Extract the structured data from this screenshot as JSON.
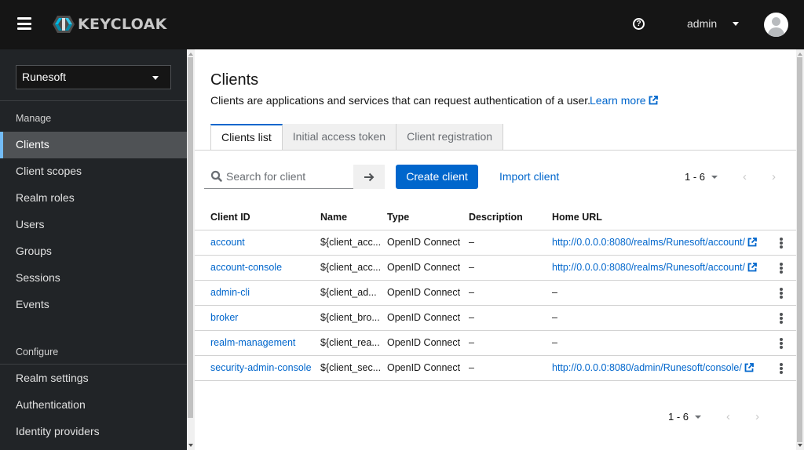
{
  "header": {
    "brand": "KEYCLOAK",
    "help_icon": "question-circle-icon",
    "user_name": "admin",
    "avatar_icon": "user-avatar-icon"
  },
  "sidebar": {
    "realm": "Runesoft",
    "groups": [
      {
        "title": "Manage",
        "items": [
          {
            "label": "Clients",
            "active": true
          },
          {
            "label": "Client scopes"
          },
          {
            "label": "Realm roles"
          },
          {
            "label": "Users"
          },
          {
            "label": "Groups"
          },
          {
            "label": "Sessions"
          },
          {
            "label": "Events"
          }
        ]
      },
      {
        "title": "Configure",
        "items": [
          {
            "label": "Realm settings"
          },
          {
            "label": "Authentication"
          },
          {
            "label": "Identity providers"
          }
        ]
      }
    ]
  },
  "page": {
    "title": "Clients",
    "description": "Clients are applications and services that can request authentication of a user.",
    "learn_more": "Learn more",
    "tabs": [
      {
        "label": "Clients list",
        "active": true
      },
      {
        "label": "Initial access token"
      },
      {
        "label": "Client registration"
      }
    ]
  },
  "toolbar": {
    "search_placeholder": "Search for client",
    "search_value": "",
    "create_label": "Create client",
    "import_label": "Import client",
    "pagination": "1 - 6",
    "prev": "‹",
    "next": "›"
  },
  "table": {
    "columns": [
      "Client ID",
      "Name",
      "Type",
      "Description",
      "Home URL"
    ],
    "rows": [
      {
        "client_id": "account",
        "name": "${client_acc...",
        "type": "OpenID Connect",
        "description": "–",
        "home_url": "http://0.0.0.0:8080/realms/Runesoft/account/",
        "is_link": true
      },
      {
        "client_id": "account-console",
        "name": "${client_acc...",
        "type": "OpenID Connect",
        "description": "–",
        "home_url": "http://0.0.0.0:8080/realms/Runesoft/account/",
        "is_link": true
      },
      {
        "client_id": "admin-cli",
        "name": "${client_ad...",
        "type": "OpenID Connect",
        "description": "–",
        "home_url": "–",
        "is_link": false
      },
      {
        "client_id": "broker",
        "name": "${client_bro...",
        "type": "OpenID Connect",
        "description": "–",
        "home_url": "–",
        "is_link": false
      },
      {
        "client_id": "realm-management",
        "name": "${client_rea...",
        "type": "OpenID Connect",
        "description": "–",
        "home_url": "–",
        "is_link": false
      },
      {
        "client_id": "security-admin-console",
        "name": "${client_sec...",
        "type": "OpenID Connect",
        "description": "–",
        "home_url": "http://0.0.0.0:8080/admin/Runesoft/console/",
        "is_link": true
      }
    ]
  },
  "footer_pagination": {
    "range": "1 - 6",
    "prev": "‹",
    "next": "›"
  },
  "colors": {
    "masthead": "#151515",
    "sidebar": "#212427",
    "sidebar_active": "#4f5255",
    "active_indicator": "#73bcf7",
    "primary": "#0066cc"
  }
}
